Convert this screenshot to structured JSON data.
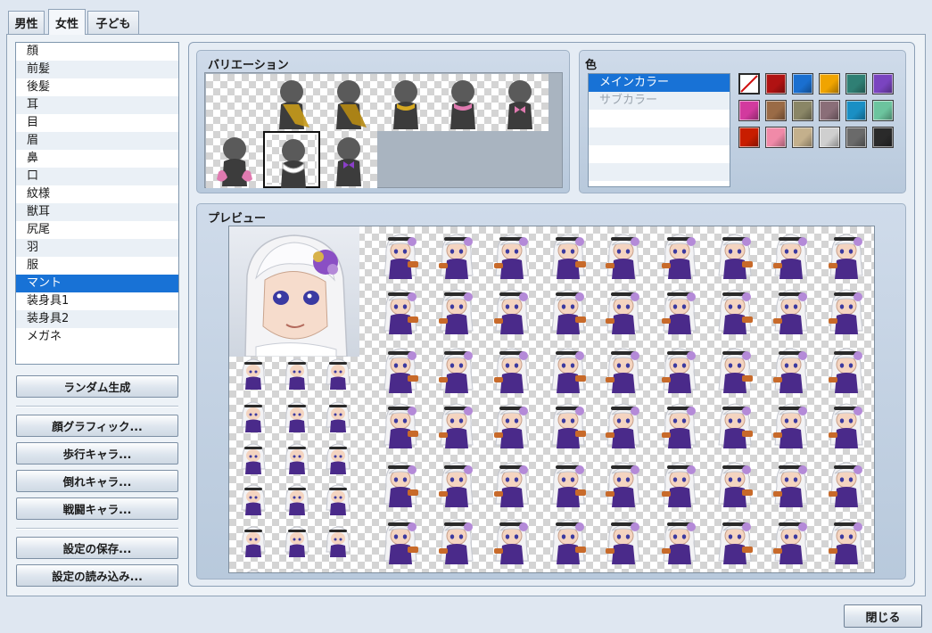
{
  "tabs": [
    {
      "label": "男性",
      "active": false
    },
    {
      "label": "女性",
      "active": true
    },
    {
      "label": "子ども",
      "active": false
    }
  ],
  "parts": [
    "顔",
    "前髪",
    "後髪",
    "耳",
    "目",
    "眉",
    "鼻",
    "口",
    "紋様",
    "獣耳",
    "尻尾",
    "羽",
    "服",
    "マント",
    "装身具1",
    "装身具2",
    "メガネ"
  ],
  "selected_part_index": 13,
  "buttons": {
    "random": "ランダム生成",
    "face": "顔グラフィック...",
    "walk": "歩行キャラ...",
    "down": "倒れキャラ...",
    "battle": "戦闘キャラ...",
    "save": "設定の保存...",
    "load": "設定の読み込み..."
  },
  "variation": {
    "title": "バリエーション",
    "items": [
      "none",
      "gold-cape",
      "gold-cape-dark",
      "gold-scarf",
      "pink-scarf",
      "pink-bow",
      "pink-wings",
      "white-ruff",
      "purple-bow"
    ],
    "selected_index": 7
  },
  "color": {
    "title": "色",
    "rows": [
      {
        "label": "メインカラー",
        "state": "selected"
      },
      {
        "label": "サブカラー",
        "state": "disabled"
      }
    ],
    "swatches": [
      [
        "none",
        "#b01212",
        "#1a6fd0",
        "#f0a400",
        "#2f7f74",
        "#7a44c0"
      ],
      [
        "#d23a9e",
        "#9a6b46",
        "#8a8666",
        "#8a6e78",
        "#1a8fc4",
        "#6cc49e"
      ],
      [
        "#c81d00",
        "#f08aa8",
        "#c4b08c",
        "#cfcfcf",
        "#6a6a6a",
        "#2a2a2a"
      ]
    ]
  },
  "preview": {
    "title": "プレビュー",
    "hair_color": "#f2f2f4",
    "outfit_color": "#4a2a8a",
    "eye_color": "#3c3aa0"
  },
  "close_label": "閉じる"
}
